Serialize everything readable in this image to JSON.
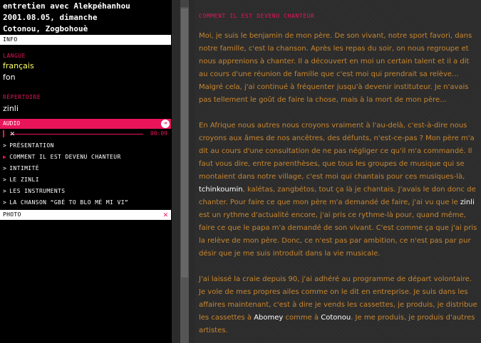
{
  "header": {
    "line1": "entretien avec Alekpéhanhou",
    "line2": "2001.08.05, dimanche",
    "line3": "Cotonou, Zogbohouè"
  },
  "info_bar": "INFO",
  "language": {
    "label": "LANGUE",
    "options": [
      "français",
      "fon"
    ]
  },
  "repertoire": {
    "label": "RÉPERTOIRE",
    "value": "zinli"
  },
  "audio": {
    "label": "AUDIO",
    "time": "00:09"
  },
  "chapters": [
    "PRÉSENTATION",
    "COMMENT IL EST DEVENU CHANTEUR",
    "INTIMITÉ",
    "LE ZINLI",
    "LES INSTRUMENTS",
    "LA CHANSON “GBÉ TO BLO MÉ MI VI”"
  ],
  "active_chapter": 1,
  "photo_bar": "PHOTO",
  "content": {
    "title": "COMMENT IL EST DEVENU CHANTEUR",
    "p1": "Moi, je suis le benjamin de mon père. De son vivant, notre sport favori, dans notre famille, c'est la chanson. Après les repas du soir, on nous regroupe et nous apprenions à chanter. Il a découvert en moi un certain talent et il a dit au cours d'une réunion de famille que c'est moi qui prendrait sa relève... Malgré cela, j'ai continué à fréquenter jusqu'à devenir instituteur. Je n'avais pas tellement le goût de faire la chose, mais à la mort de mon père...",
    "p2a": "En Afrique nous autres nous croyons vraiment à l'au-delà, c'est-à-dire nous croyons aux âmes de nos ancêtres, des défunts, n'est-ce-pas ? Mon père m'a dit au cours d'une consultation de ne pas négliger ce qu'il m'a commandé. Il faut vous dire, entre parenthèses, que tous les groupes de musique qui se montaient dans notre village, c'est moi qui chantais pour ces musiques-là, ",
    "p2_hl1": "tchinkoumin",
    "p2b": ", kalétas, zangbétos, tout ça là je chantais. J'avais le don donc de chanter. Pour faire ce que mon père m'a demandé de faire, j'ai vu que le ",
    "p2_hl2": "zinli",
    "p2c": " est un rythme d'actualité encore, j'ai pris ce rythme-là pour, quand même, faire ce que le papa m'a demandé de son vivant. C'est comme ça que j'ai pris la relève de mon père. Donc, ce n'est pas par ambition, ce n'est pas par pur désir que je me suis introduit dans la vie musicale.",
    "p3a": "J'ai laissé la craie depuis 90, j'ai adhéré au programme de départ volontaire. Je vole de mes propres ailes comme on le dit en entreprise. Je suis dans les affaires maintenant, c'est à dire je vends les cassettes, je produis, je distribue les cassettes à ",
    "p3_hl1": "Abomey",
    "p3b": " comme à ",
    "p3_hl2": "Cotonou",
    "p3c": ". Je me produis, je produis d'autres artistes."
  },
  "colors": {
    "accent": "#e8155a",
    "body_text": "#c8862f",
    "selected": "#ffff66"
  }
}
